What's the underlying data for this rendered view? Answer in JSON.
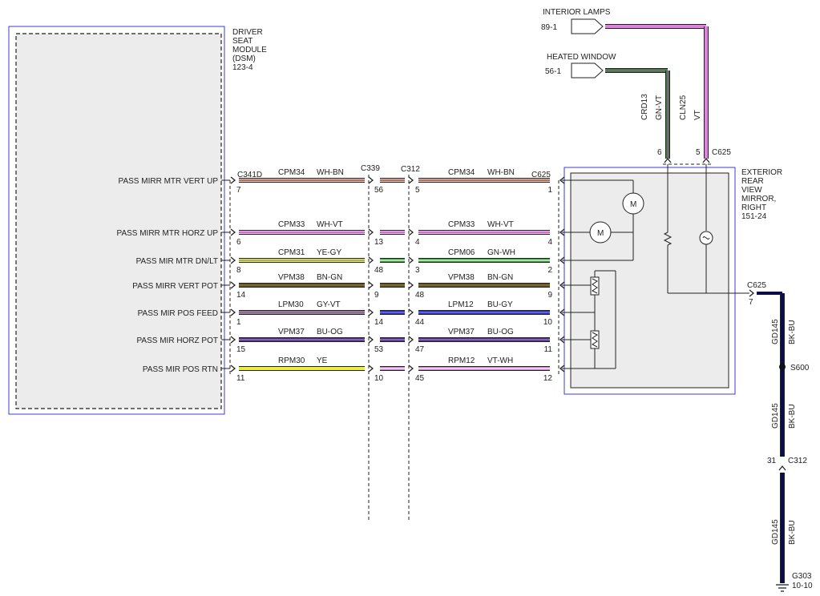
{
  "dsm": {
    "name_lines": [
      "DRIVER",
      "SEAT",
      "MODULE",
      "(DSM)",
      "123-4"
    ]
  },
  "mirror": {
    "name_lines": [
      "EXTERIOR",
      "REAR",
      "VIEW",
      "MIRROR,",
      "RIGHT",
      "151-24"
    ]
  },
  "motor_label": "M",
  "connectors": {
    "dsm": "C341D",
    "c339": "C339",
    "c312": "C312",
    "c625": "C625",
    "c625_top": "C625",
    "c625_gnd": "C625",
    "c312_gnd": "C312"
  },
  "signals": [
    {
      "label": "PASS MIRR MTR VERT UP",
      "p_dsm": "7",
      "w1_circuit": "CPM34",
      "w1_color_code": "WH-BN",
      "w1_color": "#e8c4c4",
      "w1_stripe": "#8b4513",
      "p_c339": "56",
      "p_c312": "5",
      "w2_circuit": "CPM34",
      "w2_color_code": "WH-BN",
      "w2_color": "#e8c4c4",
      "w2_stripe": "#8b4513",
      "p_c625": "1"
    },
    {
      "label": "PASS MIRR MTR HORZ UP",
      "p_dsm": "6",
      "w1_circuit": "CPM33",
      "w1_color_code": "WH-VT",
      "w1_color": "#f4b8f4",
      "w1_stripe": "#b04ab0",
      "p_c339": "13",
      "p_c312": "4",
      "w2_circuit": "CPM33",
      "w2_color_code": "WH-VT",
      "w2_color": "#f4b8f4",
      "w2_stripe": "#b04ab0",
      "p_c625": "4"
    },
    {
      "label": "PASS MIR MTR DN/LT",
      "p_dsm": "8",
      "w1_circuit": "CPM31",
      "w1_color_code": "YE-GY",
      "w1_color": "#ecec3a",
      "w1_stripe": "#888888",
      "p_c339": "48",
      "p_c312": "3",
      "w2_circuit": "CPM06",
      "w2_color_code": "GN-WH",
      "w2_color": "#2fa82f",
      "w2_stripe": "#ffffff",
      "p_c625": "2"
    },
    {
      "label": "PASS MIRR VERT POT",
      "p_dsm": "14",
      "w1_circuit": "VPM38",
      "w1_color_code": "BN-GN",
      "w1_color": "#8b3a2a",
      "w1_stripe": "#2fa82f",
      "p_c339": "9",
      "p_c312": "48",
      "w2_circuit": "VPM38",
      "w2_color_code": "BN-GN",
      "w2_color": "#8b3a2a",
      "w2_stripe": "#2fa82f",
      "p_c625": "9"
    },
    {
      "label": "PASS MIR POS FEED",
      "p_dsm": "1",
      "w1_circuit": "LPM30",
      "w1_color_code": "GY-VT",
      "w1_color": "#8c8c8c",
      "w1_stripe": "#b04ab0",
      "p_c339": "14",
      "p_c312": "44",
      "w2_circuit": "LPM12",
      "w2_color_code": "BU-GY",
      "w2_color": "#2a2ae0",
      "w2_stripe": "#8c8c8c",
      "p_c625": "10"
    },
    {
      "label": "PASS MIR HORZ POT",
      "p_dsm": "15",
      "w1_circuit": "VPM37",
      "w1_color_code": "BU-OG",
      "w1_color": "#2a2ae0",
      "w1_stripe": "#f08a00",
      "p_c339": "53",
      "p_c312": "47",
      "w2_circuit": "VPM37",
      "w2_color_code": "BU-OG",
      "w2_color": "#2a2ae0",
      "w2_stripe": "#f08a00",
      "p_c625": "11"
    },
    {
      "label": "PASS MIR POS RTN",
      "p_dsm": "11",
      "w1_circuit": "RPM30",
      "w1_color_code": "YE",
      "w1_color": "#ecec3a",
      "w1_stripe": "#ecec3a",
      "p_c339": "10",
      "p_c312": "45",
      "w2_circuit": "RPM12",
      "w2_color_code": "VT-WH",
      "w2_color": "#c884c8",
      "w2_stripe": "#ffffff",
      "p_c625": "12"
    }
  ],
  "feeds": [
    {
      "source": "INTERIOR LAMPS",
      "ref": "89-1",
      "circuit": "CLN25",
      "color_code": "VT",
      "color": "#e27fe2",
      "stripe": "#e27fe2",
      "pin": "5"
    },
    {
      "source": "HEATED WINDOW",
      "ref": "56-1",
      "circuit": "CRD13",
      "color_code": "GN-VT",
      "color": "#2f8a2f",
      "stripe": "#b04ab0",
      "pin": "6"
    }
  ],
  "ground": {
    "pin_c625": "7",
    "circuit": "GD145",
    "color_code": "BK-BU",
    "color": "#0c0c4a",
    "splice": "S600",
    "pin_c312": "31",
    "ground_point": "G303",
    "ground_ref": "10-10"
  }
}
